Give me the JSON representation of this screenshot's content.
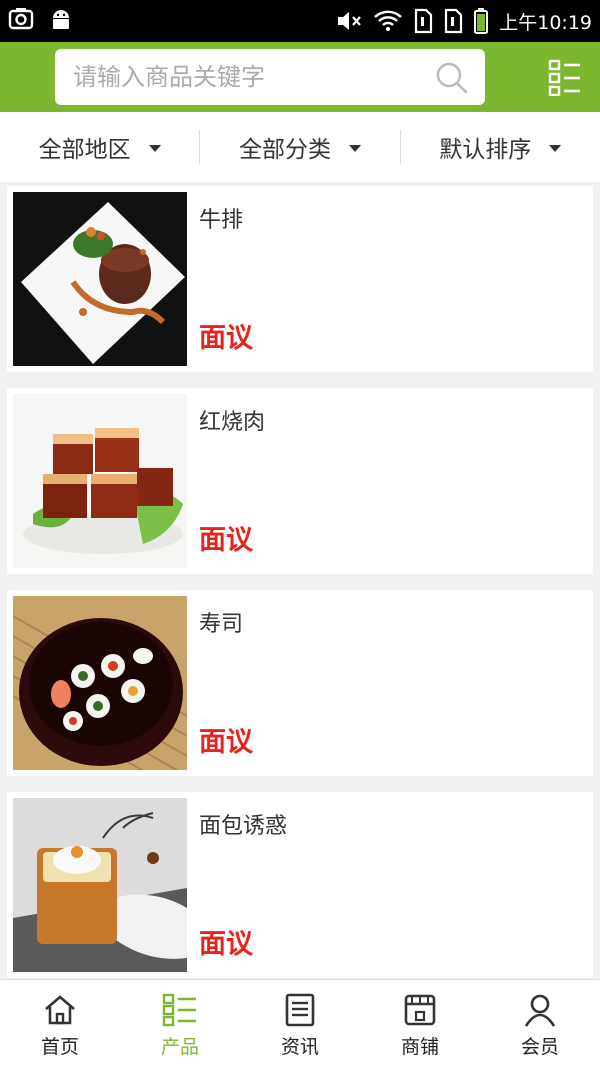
{
  "status_bar": {
    "time": "上午10:19"
  },
  "search": {
    "placeholder": "请输入商品关键字"
  },
  "filters": [
    {
      "label": "全部地区"
    },
    {
      "label": "全部分类"
    },
    {
      "label": "默认排序"
    }
  ],
  "products": [
    {
      "name": "牛排",
      "price": "面议"
    },
    {
      "name": "红烧肉",
      "price": "面议"
    },
    {
      "name": "寿司",
      "price": "面议"
    },
    {
      "name": "面包诱惑",
      "price": "面议"
    }
  ],
  "bottom_nav": [
    {
      "label": "首页",
      "icon": "home-icon"
    },
    {
      "label": "产品",
      "icon": "grid-list-icon",
      "active": true
    },
    {
      "label": "资讯",
      "icon": "news-icon"
    },
    {
      "label": "商铺",
      "icon": "shop-icon"
    },
    {
      "label": "会员",
      "icon": "user-icon"
    }
  ],
  "colors": {
    "brand_green": "#7cb82f",
    "price_red": "#e8231e"
  }
}
